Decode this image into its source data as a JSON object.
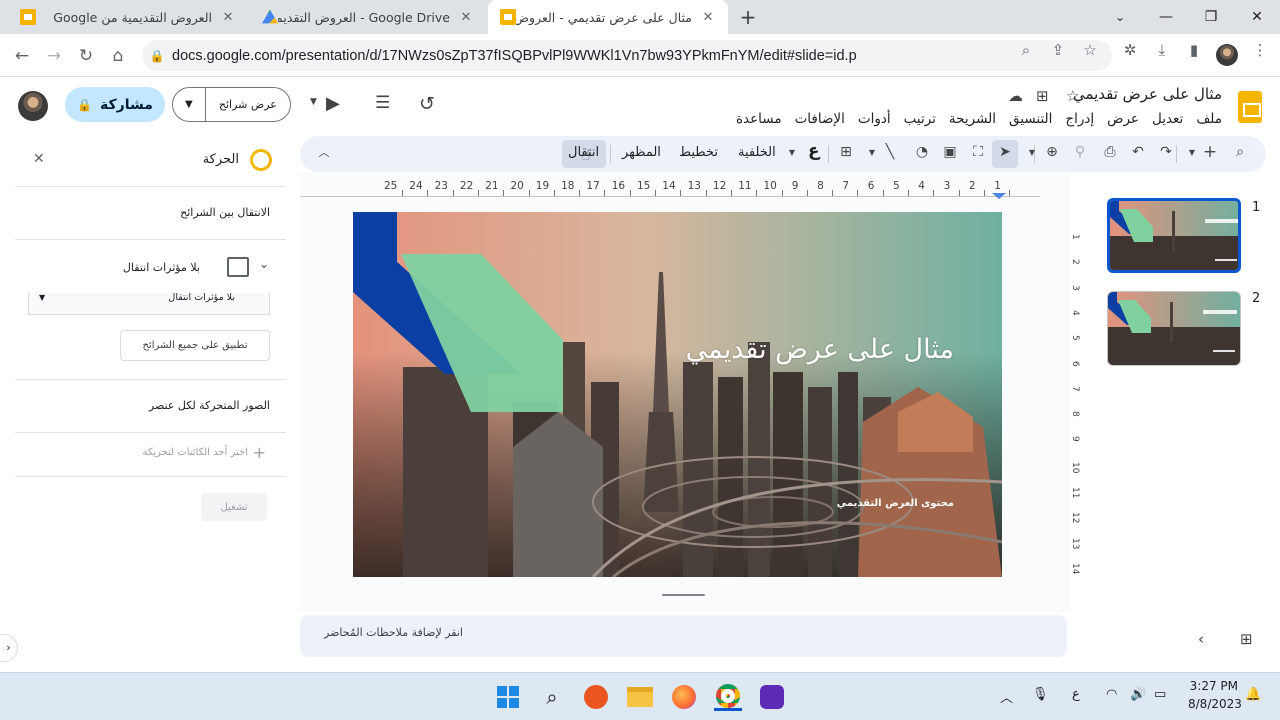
{
  "browser": {
    "tabs": [
      {
        "title": "العروض التقديمية من Google",
        "favicon": "slides-icon"
      },
      {
        "title": "Google Drive - العروض التقديمية",
        "favicon": "drive-icon"
      },
      {
        "title": "مثال على عرض تقديمي - العروض",
        "favicon": "slides-icon",
        "active": true
      }
    ],
    "new_tab_label": "+",
    "url": "docs.google.com/presentation/d/17NWzs0sZpT37fISQBPvlPl9WWKl1Vn7bw93YPkmFnYM/edit#slide=id.p",
    "window_controls": [
      "chevron-down-icon",
      "minimize-icon",
      "restore-icon",
      "close-icon"
    ]
  },
  "doc": {
    "title": "مثال على عرض تقديمي",
    "menu": [
      "ملف",
      "تعديل",
      "عرض",
      "إدراج",
      "التنسيق",
      "الشريحة",
      "ترتيب",
      "أدوات",
      "الإضافات",
      "مساعدة"
    ],
    "share_label": "مشاركة",
    "slideshow_label": "عرض شرائح"
  },
  "toolbar": {
    "transition": "انتقال",
    "theme": "المظهر",
    "layout": "تخطيط",
    "background": "الخلفية",
    "input_tools": "ع"
  },
  "motion_panel": {
    "title": "الحركة",
    "slide_transition_heading": "الانتقال بين الشرائح",
    "no_transition_label": "بلا مؤثرات انتقال",
    "dropdown_value": "بلا مؤثرات انتقال",
    "apply_all_label": "تطبيق على جميع الشرائح",
    "object_animations_heading": "الصور المتحركة لكل عنصر",
    "add_animation_label": "اختر أحد الكائنات لتحريكه",
    "play_label": "تشغيل"
  },
  "ruler": {
    "horizontal": [
      "25",
      "24",
      "23",
      "22",
      "21",
      "20",
      "19",
      "18",
      "17",
      "16",
      "15",
      "14",
      "13",
      "12",
      "11",
      "10",
      "9",
      "8",
      "7",
      "6",
      "5",
      "4",
      "3",
      "2",
      "1"
    ],
    "vertical": [
      "1",
      "2",
      "3",
      "4",
      "5",
      "6",
      "7",
      "8",
      "9",
      "10",
      "11",
      "12",
      "13",
      "14"
    ]
  },
  "slide": {
    "title": "مثال على عرض تقديمي",
    "subtitle": "محتوى العرض التقديمي"
  },
  "thumbnails": [
    {
      "number": "1",
      "title": "مثال على عرض تقديمي",
      "selected": true
    },
    {
      "number": "2",
      "title": "مثال على عرض تقديمي",
      "selected": false
    }
  ],
  "notes": {
    "placeholder": "انقر لإضافة ملاحظات المُحاضر"
  },
  "taskbar": {
    "time": "3:27 PM",
    "date": "8/8/2023",
    "language": "ع"
  },
  "colors": {
    "accent_blue": "#0b57d0",
    "share_bg": "#c2e7ff",
    "toolbar_bg": "#edf2fa",
    "slide_shape_blue": "#0b3fa3",
    "slide_shape_green": "#7fd1a0"
  }
}
